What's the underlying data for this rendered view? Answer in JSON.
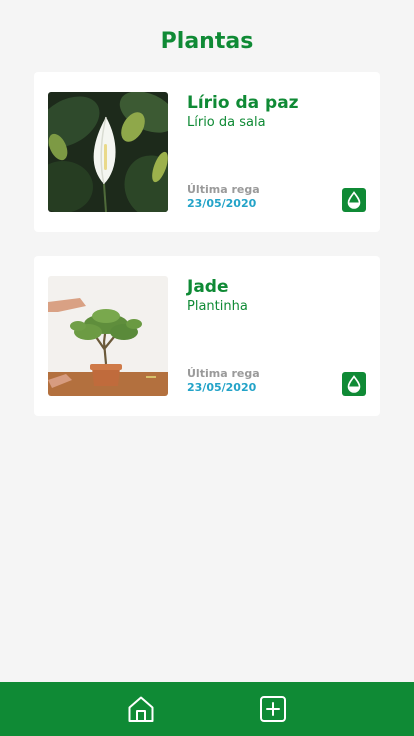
{
  "header": {
    "title": "Plantas"
  },
  "plants": [
    {
      "name": "Lírio da paz",
      "nickname": "Lírio da sala",
      "last_watering_label": "Última rega",
      "last_watering_date": "23/05/2020",
      "photo_icon": "peace-lily-photo",
      "water_icon": "water-drop-icon"
    },
    {
      "name": "Jade",
      "nickname": "Plantinha",
      "last_watering_label": "Última rega",
      "last_watering_date": "23/05/2020",
      "photo_icon": "jade-plant-photo",
      "water_icon": "water-drop-icon"
    }
  ],
  "bottom_nav": {
    "items": [
      {
        "icon": "home-icon"
      },
      {
        "icon": "add-icon"
      }
    ]
  },
  "colors": {
    "primary": "#0f8a35",
    "date": "#23a3c8",
    "muted": "#9a9a9a",
    "background": "#f5f5f5",
    "card": "#ffffff"
  }
}
